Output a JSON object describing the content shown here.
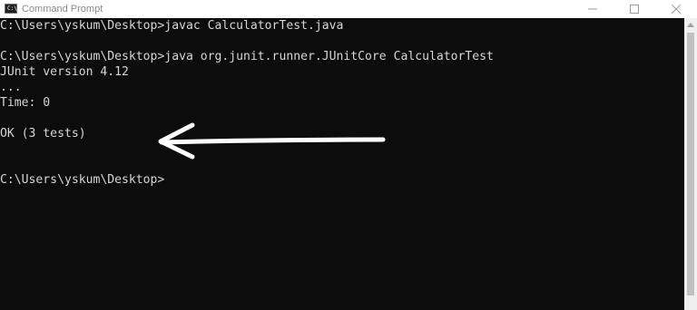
{
  "window": {
    "title": "Command Prompt",
    "icon": "cmd-icon",
    "controls": [
      "minimize-icon",
      "maximize-icon",
      "close-icon"
    ]
  },
  "console": {
    "lines": [
      "C:\\Users\\yskum\\Desktop>javac CalculatorTest.java",
      "",
      "C:\\Users\\yskum\\Desktop>java org.junit.runner.JUnitCore CalculatorTest",
      "JUnit version 4.12",
      "...",
      "Time: 0",
      "",
      "OK (3 tests)",
      "",
      "",
      "C:\\Users\\yskum\\Desktop>"
    ]
  },
  "annotation": {
    "shape": "arrow-left-icon",
    "color": "#ffffff"
  },
  "colors": {
    "console_bg": "#0c0c0c",
    "console_text": "#d6d6d6",
    "titlebar_bg": "#ffffff"
  }
}
